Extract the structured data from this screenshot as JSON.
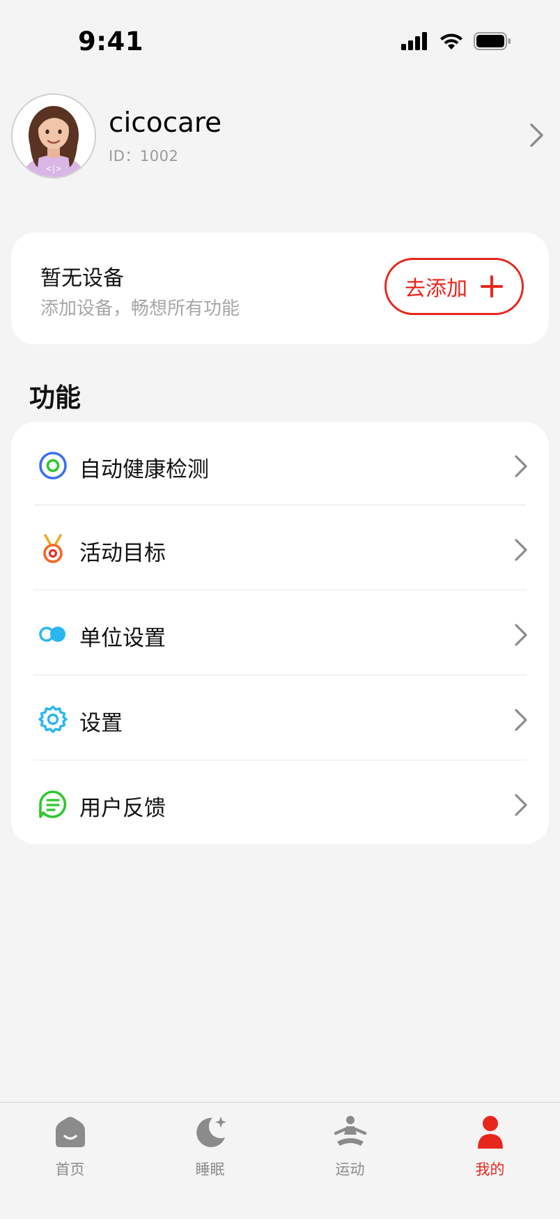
{
  "status_bar": {
    "time": "9:41"
  },
  "profile": {
    "username": "cicocare",
    "id_text": "ID：1002",
    "avatar_icon": "user-avatar-icon"
  },
  "device": {
    "title": "暂无设备",
    "subtitle": "添加设备，畅想所有功能",
    "add_label": "去添加",
    "add_icon": "plus-icon",
    "accent": "#e8261d"
  },
  "section": {
    "title": "功能"
  },
  "features": [
    {
      "label": "自动健康检测",
      "icon": "health-check-icon",
      "color": "#3a6ff2"
    },
    {
      "label": "活动目标",
      "icon": "medal-icon",
      "color": "#f26522"
    },
    {
      "label": "单位设置",
      "icon": "toggle-icon",
      "color": "#2ab6f0"
    },
    {
      "label": "设置",
      "icon": "gear-icon",
      "color": "#2ab6f0"
    },
    {
      "label": "用户反馈",
      "icon": "feedback-icon",
      "color": "#2ec72e"
    }
  ],
  "tabs": [
    {
      "label": "首页",
      "icon": "home-icon",
      "active": false
    },
    {
      "label": "睡眠",
      "icon": "moon-icon",
      "active": false
    },
    {
      "label": "运动",
      "icon": "exercise-icon",
      "active": false
    },
    {
      "label": "我的",
      "icon": "person-icon",
      "active": true
    }
  ],
  "colors": {
    "background": "#f4f4f4",
    "card": "#ffffff",
    "active_tab": "#e8261d",
    "inactive_tab": "#8b8b8b"
  }
}
